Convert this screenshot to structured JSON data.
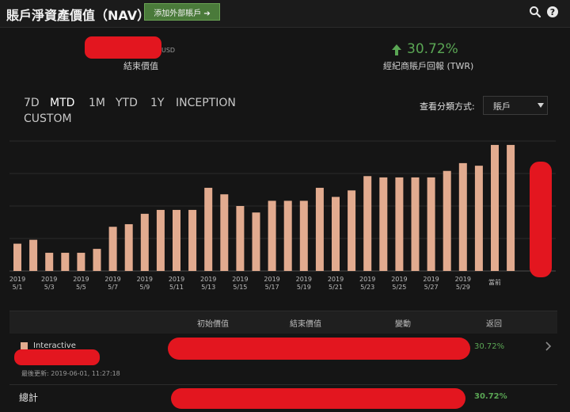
{
  "header": {
    "title": "賬戶淨資產價值（NAV）",
    "add_external_account": "添加外部賬戶 ➔",
    "search_icon": "search-icon",
    "help_icon": "help-icon"
  },
  "summary": {
    "nav_currency": "USD",
    "nav_label": "結束價值",
    "twr_value": "30.72%",
    "twr_label": "經紀商賬戶回報 (TWR)",
    "twr_arrow_icon": "arrow-up-icon"
  },
  "period_tabs": [
    {
      "label": "7D",
      "active": false
    },
    {
      "label": "MTD",
      "active": true
    },
    {
      "label": "1M",
      "active": false
    },
    {
      "label": "YTD",
      "active": false
    },
    {
      "label": "1Y",
      "active": false
    },
    {
      "label": "INCEPTION",
      "active": false
    },
    {
      "label": "CUSTOM",
      "active": false
    }
  ],
  "view_by": {
    "label": "查看分類方式:",
    "selected": "賬戶",
    "chevron_icon": "caret-down-icon"
  },
  "chart_data": {
    "type": "bar",
    "bar_color": "#e2ab8f",
    "grid": true,
    "ylim": [
      0,
      1
    ],
    "x_tick_labels": [
      {
        "index": 0,
        "label": "2019\n5/1"
      },
      {
        "index": 2,
        "label": "2019\n5/3"
      },
      {
        "index": 4,
        "label": "2019\n5/5"
      },
      {
        "index": 6,
        "label": "2019\n5/7"
      },
      {
        "index": 8,
        "label": "2019\n5/9"
      },
      {
        "index": 10,
        "label": "2019\n5/11"
      },
      {
        "index": 12,
        "label": "2019\n5/13"
      },
      {
        "index": 14,
        "label": "2019\n5/15"
      },
      {
        "index": 16,
        "label": "2019\n5/17"
      },
      {
        "index": 18,
        "label": "2019\n5/19"
      },
      {
        "index": 20,
        "label": "2019\n5/21"
      },
      {
        "index": 22,
        "label": "2019\n5/23"
      },
      {
        "index": 24,
        "label": "2019\n5/25"
      },
      {
        "index": 26,
        "label": "2019\n5/27"
      },
      {
        "index": 28,
        "label": "2019\n5/29"
      },
      {
        "index": 30,
        "label": "當前"
      }
    ],
    "values": [
      0.21,
      0.24,
      0.14,
      0.14,
      0.14,
      0.17,
      0.34,
      0.36,
      0.44,
      0.47,
      0.47,
      0.47,
      0.64,
      0.59,
      0.5,
      0.45,
      0.54,
      0.54,
      0.54,
      0.64,
      0.57,
      0.62,
      0.73,
      0.72,
      0.72,
      0.72,
      0.72,
      0.77,
      0.83,
      0.81,
      0.97,
      0.97
    ]
  },
  "table": {
    "headers": [
      "初始價值",
      "結束價值",
      "變動",
      "返回"
    ],
    "rows": [
      {
        "swatch_color": "#e2ab8f",
        "name": "Interactive",
        "updated": "最後更新: 2019-06-01, 11:27:18",
        "return": "30.72%",
        "chevron_icon": "chevron-right-icon"
      }
    ],
    "total": {
      "label": "總計",
      "return": "30.72%"
    }
  }
}
